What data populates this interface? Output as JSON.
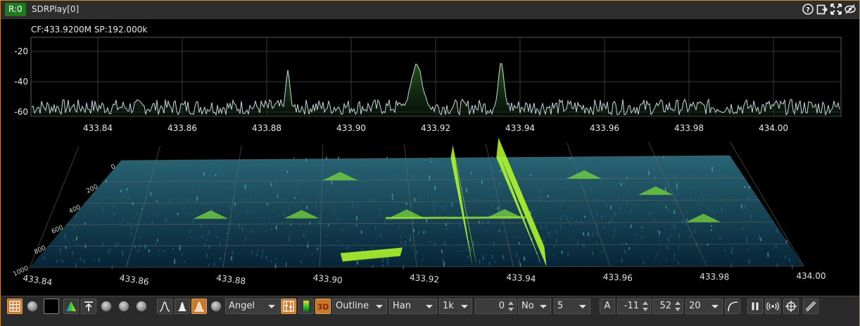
{
  "window": {
    "badge": "R:0",
    "title": "SDRPlay[0]"
  },
  "title_icons": [
    "help-icon",
    "export-icon",
    "maximize-icon",
    "hide-icon"
  ],
  "spectrum": {
    "info": "CF:433.9200M SP:192.000k",
    "y_ticks": [
      "-20",
      "-40",
      "-60"
    ],
    "x_ticks": [
      "433.84",
      "433.86",
      "433.88",
      "433.90",
      "433.92",
      "433.94",
      "433.96",
      "433.98",
      "434.00"
    ],
    "waterfall_x_ticks": [
      "433.84",
      "433.86",
      "433.88",
      "433.90",
      "433.92",
      "433.94",
      "433.96",
      "433.98",
      "434.00"
    ],
    "waterfall_time_ticks": [
      "1000",
      "800",
      "600",
      "400",
      "200",
      "0"
    ],
    "colors": {
      "trace": "#c8d4dc",
      "fill_top": "#3a8a2a",
      "grid": "#5a5a5a",
      "waterfall_low": "#0a3a5a",
      "waterfall_high": "#b8ff2a"
    }
  },
  "toolbar": {
    "window_fn": "Angel",
    "style": "Outline",
    "window": "Han",
    "fft_size": "1k",
    "overlap": "0",
    "averaging_mode": "No",
    "averaging": "5",
    "auto_label": "A",
    "ref_level": "-11",
    "range": "52",
    "fps": "20"
  }
}
